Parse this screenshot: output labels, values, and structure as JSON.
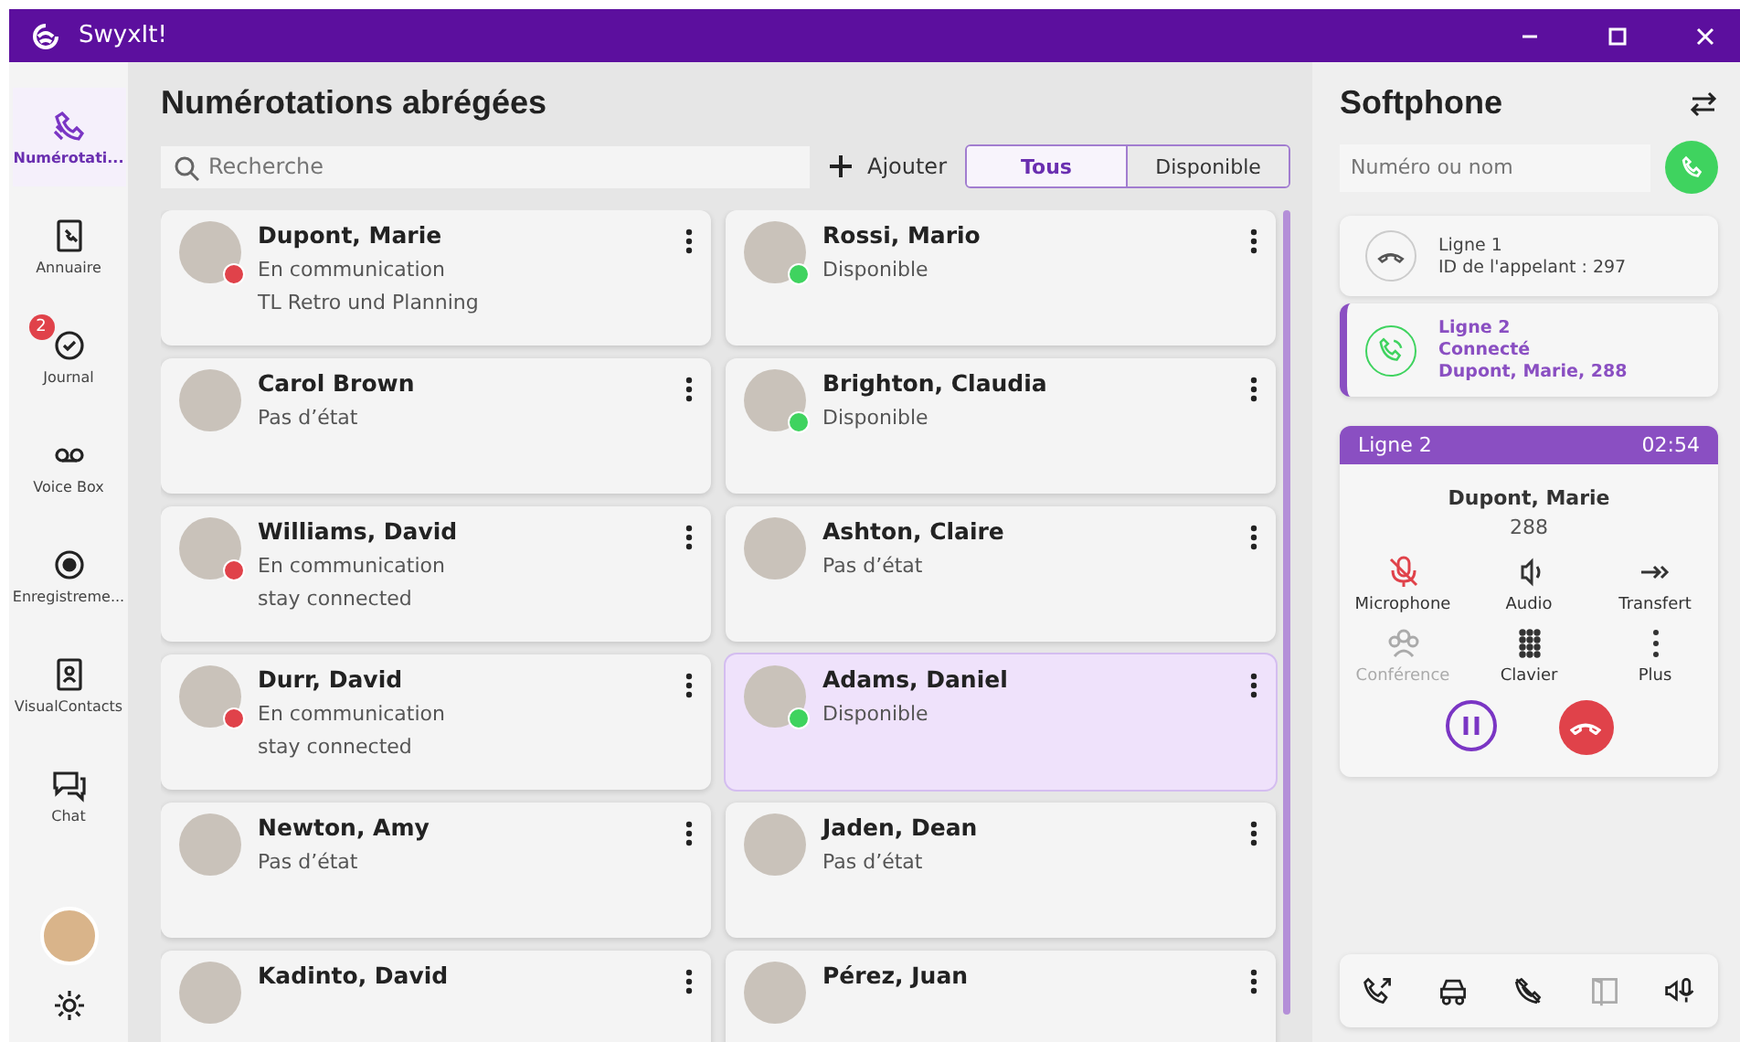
{
  "window": {
    "title": "SwyxIt!"
  },
  "sidebar": {
    "items": [
      {
        "kind": "speed",
        "label": "Numérotati...",
        "selected": true
      },
      {
        "kind": "book",
        "label": "Annuaire",
        "selected": false
      },
      {
        "kind": "journal",
        "label": "Journal",
        "selected": false,
        "badge": "2"
      },
      {
        "kind": "voicebox",
        "label": "Voice Box",
        "selected": false
      },
      {
        "kind": "record",
        "label": "Enregistreme...",
        "selected": false
      },
      {
        "kind": "contacts",
        "label": "VisualContacts",
        "selected": false
      },
      {
        "kind": "chat",
        "label": "Chat",
        "selected": false
      }
    ]
  },
  "main": {
    "title": "Numérotations abrégées",
    "search": {
      "placeholder": "Recherche"
    },
    "add_button": "Ajouter",
    "filters": [
      {
        "label": "Tous",
        "selected": true
      },
      {
        "label": "Disponible",
        "selected": false
      }
    ],
    "contacts": [
      {
        "name": "Dupont, Marie",
        "status": "En communication",
        "note": "TL Retro und Planning",
        "color": "#e0424a",
        "selected": false
      },
      {
        "name": "Rossi, Mario",
        "status": "Disponible",
        "color": "#3fd35f",
        "selected": false
      },
      {
        "name": "Carol Brown",
        "status": "Pas d’état",
        "selected": false
      },
      {
        "name": "Brighton, Claudia",
        "status": "Disponible",
        "color": "#3fd35f",
        "selected": false
      },
      {
        "name": "Williams, David",
        "status": "En communication",
        "note": "stay connected",
        "color": "#e0424a",
        "selected": false
      },
      {
        "name": "Ashton, Claire",
        "status": "Pas d’état",
        "selected": false
      },
      {
        "name": "Durr, David",
        "status": "En communication",
        "note": "stay connected",
        "color": "#e0424a",
        "selected": false
      },
      {
        "name": "Adams, Daniel",
        "status": "Disponible",
        "color": "#3fd35f",
        "selected": true
      },
      {
        "name": "Newton, Amy",
        "status": "Pas d’état",
        "selected": false
      },
      {
        "name": "Jaden, Dean",
        "status": "Pas d’état",
        "selected": false
      },
      {
        "name": "Kadinto, David",
        "selected": false
      },
      {
        "name": "Pérez, Juan",
        "selected": false
      }
    ]
  },
  "softphone": {
    "title": "Softphone",
    "dial": {
      "placeholder": "Numéro ou nom"
    },
    "lines": [
      {
        "title": "Ligne 1",
        "lines": [
          "ID de l'appelant : 297"
        ],
        "selected": false
      },
      {
        "title": "Ligne 2",
        "lines": [
          "Connecté",
          "Dupont, Marie, 288"
        ],
        "selected": true
      }
    ],
    "call": {
      "line": "Ligne 2",
      "time": "02:54",
      "name": "Dupont, Marie",
      "number": "288",
      "actions": [
        {
          "kind": "mic",
          "label": "Microphone",
          "disabled": false,
          "active": true
        },
        {
          "kind": "audio",
          "label": "Audio",
          "disabled": false,
          "active": false
        },
        {
          "kind": "transfer",
          "label": "Transfert",
          "disabled": false,
          "active": false
        },
        {
          "kind": "conference",
          "label": "Conférence",
          "disabled": true,
          "active": false
        },
        {
          "kind": "keypad",
          "label": "Clavier",
          "disabled": false,
          "active": false
        },
        {
          "kind": "more",
          "label": "Plus",
          "disabled": false,
          "active": false
        }
      ]
    },
    "toolbar": [
      {
        "kind": "callback",
        "disabled": false
      },
      {
        "kind": "car",
        "disabled": false
      },
      {
        "kind": "nomic",
        "disabled": false
      },
      {
        "kind": "panel",
        "disabled": true
      },
      {
        "kind": "speaker",
        "disabled": false
      }
    ]
  }
}
